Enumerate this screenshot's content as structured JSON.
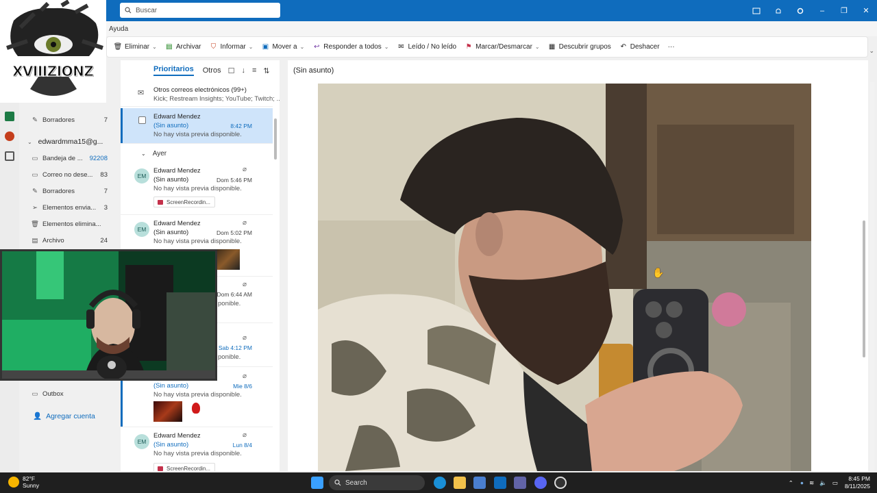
{
  "titlebar": {
    "search_placeholder": "Buscar"
  },
  "menubar": {
    "help": "Ayuda"
  },
  "ribbon": {
    "delete": "Eliminar",
    "archive": "Archivar",
    "report": "Informar",
    "move": "Mover a",
    "reply_all": "Responder a todos",
    "read_unread": "Leído / No leído",
    "flag": "Marcar/Desmarcar",
    "groups": "Descubrir grupos",
    "undo": "Deshacer",
    "more": "···"
  },
  "logo": {
    "text": "XVIIIZIONZ"
  },
  "folders_top": [
    {
      "label": "Borradores",
      "count": "7"
    }
  ],
  "account": {
    "email": "edwardmma15@g..."
  },
  "folders": [
    {
      "label": "Bandeja de ...",
      "count": "92208"
    },
    {
      "label": "Correo no dese...",
      "count": "83"
    },
    {
      "label": "Borradores",
      "count": "7"
    },
    {
      "label": "Elementos envia...",
      "count": "3"
    },
    {
      "label": "Elementos elimina...",
      "count": ""
    },
    {
      "label": "Archivo",
      "count": "24"
    }
  ],
  "outbox": "Outbox",
  "add_account": "Agregar cuenta",
  "message_list": {
    "tab_focused": "Prioritarios",
    "tab_other": "Otros",
    "other_mail": {
      "title": "Otros correos electrónicos (99+)",
      "preview": "Kick; Restream Insights; YouTube; Twitch; ..."
    },
    "group_yesterday": "Ayer",
    "items": [
      {
        "sender": "Edward Mendez",
        "subject": "(Sin asunto)",
        "time": "8:42 PM",
        "preview": "No hay vista previa disponible."
      },
      {
        "initials": "EM",
        "sender": "Edward Mendez",
        "subject": "(Sin asunto)",
        "time": "Dom 5:46 PM",
        "preview": "No hay vista previa disponible.",
        "attachment": "ScreenRecordin..."
      },
      {
        "initials": "EM",
        "sender": "Edward Mendez",
        "subject": "(Sin asunto)",
        "time": "Dom 5:02 PM",
        "preview": "No hay vista previa disponible."
      },
      {
        "time": "Dom 6:44 AM",
        "preview": "ponible."
      },
      {
        "time": "Sab 4:12 PM",
        "preview": "ponible."
      },
      {
        "subject": "(Sin asunto)",
        "time": "Mie 8/6",
        "preview": "No hay vista previa disponible."
      },
      {
        "initials": "EM",
        "sender": "Edward Mendez",
        "subject": "(Sin asunto)",
        "time": "Lun 8/4",
        "preview": "No hay vista previa disponible.",
        "attachment": "ScreenRecordin..."
      }
    ]
  },
  "reading_pane": {
    "subject": "(Sin asunto)"
  },
  "taskbar": {
    "temp": "82°F",
    "condition": "Sunny",
    "search": "Search",
    "time": "8:45 PM",
    "date": "8/11/2025"
  },
  "colors": {
    "accent": "#0f6cbd",
    "selected": "#cfe4fa",
    "webcam_green": "#1fae63"
  }
}
